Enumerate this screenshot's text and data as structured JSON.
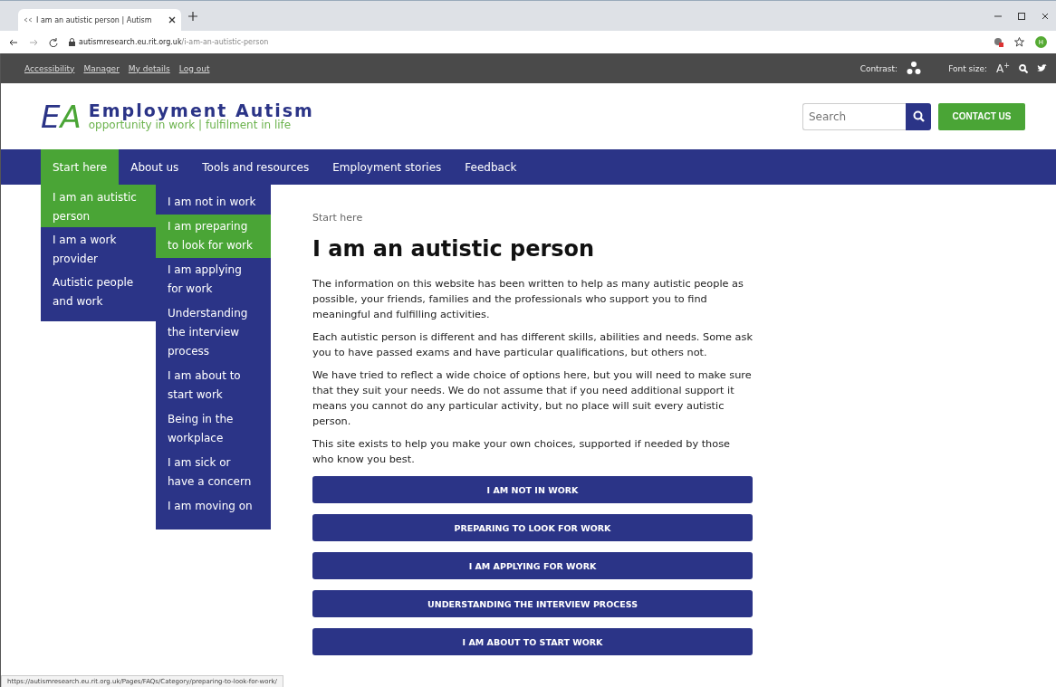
{
  "browser": {
    "tab_title": "I am an autistic person | Autism",
    "url_host": "autismresearch.eu.rit.org.uk",
    "url_path": "/i-am-an-autistic-person",
    "profile": "H"
  },
  "utility_bar": {
    "links": [
      "Accessibility",
      "Manager",
      "My details",
      "Log out"
    ],
    "contrast_label": "Contrast:",
    "font_size_label": "Font size:",
    "font_size_button": "A",
    "font_size_mark": "+"
  },
  "header": {
    "logo_e": "E",
    "logo_a": "A",
    "title": "Employment Autism",
    "tagline": "opportunity in work | fulfilment in life",
    "search": {
      "placeholder": "Search"
    },
    "contact_button": "CONTACT US"
  },
  "nav": [
    {
      "label": "Start here",
      "selected": true
    },
    {
      "label": "About us",
      "selected": false
    },
    {
      "label": "Tools and resources",
      "selected": false
    },
    {
      "label": "Employment stories",
      "selected": false
    },
    {
      "label": "Feedback",
      "selected": false
    }
  ],
  "menu_level_1": [
    {
      "label": "I am an autistic person",
      "selected": true
    },
    {
      "label": "I am a work provider",
      "selected": false
    },
    {
      "label": "Autistic people and work",
      "selected": false
    }
  ],
  "menu_level_2": [
    {
      "label": "I am not in work",
      "selected": false
    },
    {
      "label": "I am preparing to look for work",
      "selected": true
    },
    {
      "label": "I am applying for work",
      "selected": false
    },
    {
      "label": "Understanding the interview process",
      "selected": false
    },
    {
      "label": "I am about to start work",
      "selected": false
    },
    {
      "label": "Being in the workplace",
      "selected": false
    },
    {
      "label": "I am sick or have a concern",
      "selected": false
    },
    {
      "label": "I am moving on",
      "selected": false
    }
  ],
  "breadcrumb": "Start here",
  "heading": "I am an autistic person",
  "paragraphs": [
    "The information on this website has been written to help as many autistic people as possible, your friends, families and the professionals who support you to find meaningful and fulfilling activities.",
    "Each autistic person is different and has different skills, abilities and needs. Some ask you to have passed exams and have particular qualifications, but others not.",
    "We have tried to reflect a wide choice of options here, but you will need to make sure that they suit your needs. We do not assume that if you need additional support it means you cannot do any particular activity, but no place will suit every autistic person.",
    "This site exists to help you make your own choices, supported if needed by those who know you best."
  ],
  "buttons": [
    "I AM NOT IN WORK",
    "PREPARING TO LOOK FOR WORK",
    "I AM APPLYING FOR WORK",
    "UNDERSTANDING THE INTERVIEW PROCESS",
    "I AM ABOUT TO START WORK"
  ],
  "status_url": "https://autismresearch.eu.rit.org.uk/Pages/FAQs/Category/preparing-to-look-for-work/"
}
